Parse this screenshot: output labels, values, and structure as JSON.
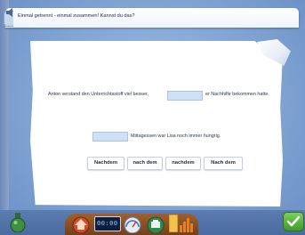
{
  "instruction": "Einmal getrennt - einmal zusammen! Kannst du das?",
  "exercise": {
    "sentence1": {
      "before": "Anton verstand den Unterrichtsstoff viel besser,",
      "after": "er Nachhilfe bekommen hatte."
    },
    "sentence2": {
      "after": "Mittagessen war Lisa noch immer hungrig."
    },
    "options": [
      "Nachdem",
      "nach dem",
      "nachdem",
      "Nach dem"
    ]
  },
  "toolbar": {
    "clock_text": "00:00"
  },
  "colors": {
    "background": "#86a9d6",
    "blank": "#cfe0f5",
    "toolbar_wood": "#8a4f22",
    "check": "#4caf36"
  }
}
